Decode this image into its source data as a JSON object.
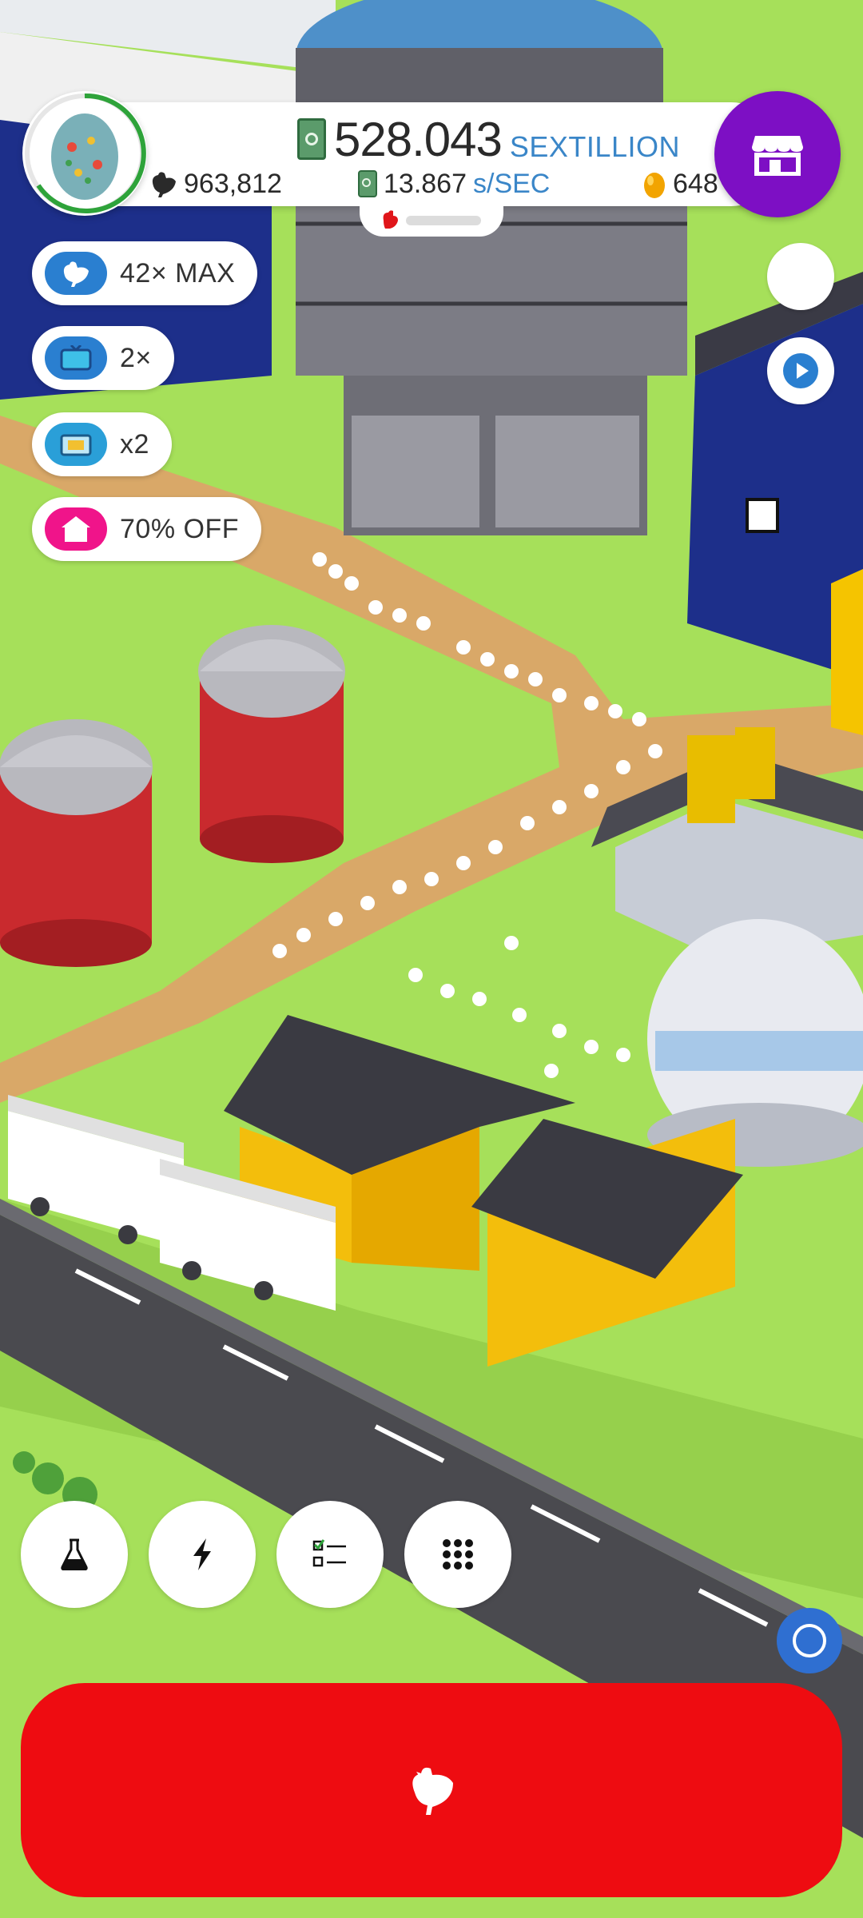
{
  "hud": {
    "money_value": "528.043",
    "money_unit": "SEXTILLION",
    "chicken_count": "963,812",
    "rate_value": "13.867",
    "rate_unit": "s/SEC",
    "golden_eggs": "648"
  },
  "boosts": [
    {
      "label": "42× MAX",
      "icon": "chicken-icon",
      "color": "#2a7fd0"
    },
    {
      "label": "2×",
      "icon": "tv-icon",
      "color": "#2a7fd0"
    },
    {
      "label": "x2",
      "icon": "boost-box-icon",
      "color": "#2a9fd8"
    },
    {
      "label": "70% OFF",
      "icon": "house-icon",
      "color": "#f0148a"
    }
  ],
  "toolbar": {
    "research": "flask-icon",
    "boosts": "lightning-icon",
    "missions": "checklist-icon",
    "menu": "grid-menu-icon"
  },
  "hatch_button": {
    "icon": "chicken-icon",
    "color": "#ee0c11"
  },
  "colors": {
    "grass": "#a6e05a",
    "shop": "#7d0fc4",
    "accent_blue": "#3a86c8"
  }
}
